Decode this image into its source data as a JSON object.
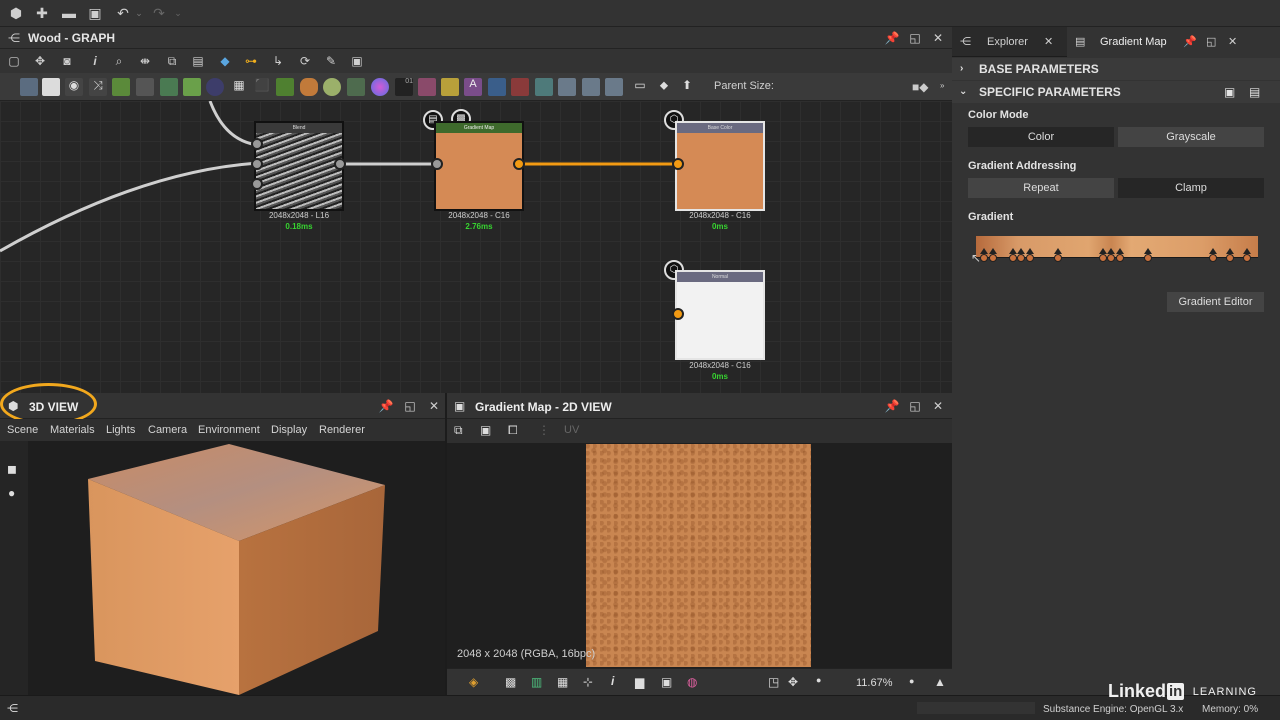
{
  "top_toolbar": {
    "icons": [
      "new-package-icon",
      "add-icon",
      "open-folder-icon",
      "save-icon",
      "undo-icon",
      "redo-icon"
    ]
  },
  "graph": {
    "title": "Wood - GRAPH",
    "parent_size_label": "Parent Size:",
    "nodes": [
      {
        "title": "Blend",
        "size": "2048x2048 - L16",
        "time": "0.18ms"
      },
      {
        "title": "Gradient Map",
        "size": "2048x2048 - C16",
        "time": "2.76ms"
      },
      {
        "title": "Base Color",
        "size": "2048x2048 - C16",
        "time": "0ms"
      },
      {
        "title": "Normal",
        "size": "2048x2048 - C16",
        "time": "0ms"
      }
    ]
  },
  "view3d": {
    "title": "3D VIEW",
    "menu": [
      "Scene",
      "Materials",
      "Lights",
      "Camera",
      "Environment",
      "Display",
      "Renderer"
    ]
  },
  "view2d": {
    "title": "Gradient Map - 2D VIEW",
    "uv_label": "UV",
    "image_info": "2048 x 2048 (RGBA, 16bpc)",
    "zoom": "11.67%"
  },
  "right_panel": {
    "tabs": [
      {
        "label": "Explorer"
      },
      {
        "label": "Gradient Map"
      }
    ],
    "sections": {
      "base": "BASE PARAMETERS",
      "specific": "SPECIFIC PARAMETERS"
    },
    "color_mode": {
      "label": "Color Mode",
      "options": [
        "Color",
        "Grayscale"
      ],
      "selected": "Grayscale"
    },
    "gradient_addressing": {
      "label": "Gradient Addressing",
      "options": [
        "Repeat",
        "Clamp"
      ],
      "selected": "Repeat"
    },
    "gradient": {
      "label": "Gradient",
      "stops": [
        0.03,
        0.06,
        0.13,
        0.16,
        0.19,
        0.29,
        0.45,
        0.48,
        0.51,
        0.61,
        0.84,
        0.9,
        0.96
      ]
    },
    "gradient_editor_button": "Gradient Editor"
  },
  "status_bar": {
    "engine": "Substance Engine: OpenGL 3.x",
    "memory": "Memory: 0%"
  },
  "watermark": {
    "brand": "Linked",
    "brand_in": "in",
    "suffix": "LEARNING"
  },
  "colors": {
    "accent_orange": "#f29a13",
    "wood": "#d58a55",
    "timing_green": "#37d430",
    "highlight_ring": "#f2a81d"
  }
}
